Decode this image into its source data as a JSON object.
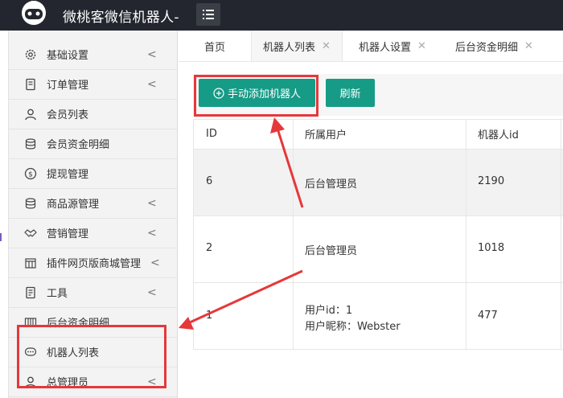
{
  "header": {
    "app_title": "微桃客微信机器人-",
    "logo_icon": "robot-logo",
    "menu_icon": "hamburger-menu-icon"
  },
  "sidebar": {
    "items": [
      {
        "label": "基础设置",
        "icon": "gear-icon",
        "has_chevron": true
      },
      {
        "label": "订单管理",
        "icon": "order-doc-icon",
        "has_chevron": true
      },
      {
        "label": "会员列表",
        "icon": "user-icon",
        "has_chevron": false
      },
      {
        "label": "会员资金明细",
        "icon": "database-icon",
        "has_chevron": false
      },
      {
        "label": "提现管理",
        "icon": "dollar-icon",
        "has_chevron": false
      },
      {
        "label": "商品源管理",
        "icon": "database-icon",
        "has_chevron": true
      },
      {
        "label": "营销管理",
        "icon": "handshake-icon",
        "has_chevron": true
      },
      {
        "label": "插件网页版商城管理",
        "icon": "store-icon",
        "has_chevron": true
      },
      {
        "label": "工具",
        "icon": "tool-doc-icon",
        "has_chevron": true
      },
      {
        "label": "后台资金明细",
        "icon": "columns-icon",
        "has_chevron": false
      },
      {
        "label": "机器人列表",
        "icon": "chat-bubble-icon",
        "has_chevron": false
      },
      {
        "label": "总管理员",
        "icon": "user-icon",
        "has_chevron": true
      }
    ],
    "chevron": "<"
  },
  "tabs": [
    {
      "label": "首页",
      "closable": false
    },
    {
      "label": "机器人列表",
      "closable": true,
      "active": true
    },
    {
      "label": "机器人设置",
      "closable": true
    },
    {
      "label": "后台资金明细",
      "closable": true
    }
  ],
  "toolbar": {
    "add_label": "手动添加机器人",
    "add_icon": "plus-circle-icon",
    "refresh_label": "刷新"
  },
  "table": {
    "headers": [
      "ID",
      "所属用户",
      "机器人id"
    ],
    "rows": [
      {
        "id": "6",
        "user_lines": [
          "后台管理员"
        ],
        "robot_id": "2190"
      },
      {
        "id": "2",
        "user_lines": [
          "后台管理员"
        ],
        "robot_id": "1018"
      },
      {
        "id": "1",
        "user_lines": [
          "用户id：1",
          "用户昵称：Webster"
        ],
        "robot_id": "477"
      }
    ]
  },
  "colors": {
    "accent": "#169b87",
    "topbar": "#23262e",
    "annotation_red": "#e5383b"
  }
}
